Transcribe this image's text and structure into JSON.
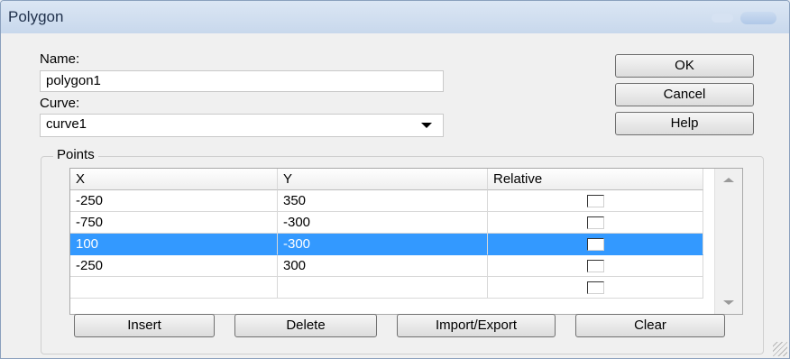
{
  "window": {
    "title": "Polygon"
  },
  "form": {
    "name_label": "Name:",
    "name_value": "polygon1",
    "curve_label": "Curve:",
    "curve_value": "curve1"
  },
  "side_buttons": {
    "ok": "OK",
    "cancel": "Cancel",
    "help": "Help"
  },
  "points": {
    "group_label": "Points",
    "columns": [
      "X",
      "Y",
      "Relative"
    ],
    "rows": [
      {
        "x": "-250",
        "y": "350",
        "relative": false
      },
      {
        "x": "-750",
        "y": "-300",
        "relative": false
      },
      {
        "x": "100",
        "y": "-300",
        "relative": false,
        "selected": true
      },
      {
        "x": "-250",
        "y": "300",
        "relative": false
      },
      {
        "x": "",
        "y": "",
        "relative": false
      }
    ]
  },
  "bottom_buttons": {
    "insert": "Insert",
    "delete": "Delete",
    "import_export": "Import/Export",
    "clear": "Clear"
  },
  "colors": {
    "selection": "#3399ff",
    "title_bg": "#c8d8ec"
  }
}
